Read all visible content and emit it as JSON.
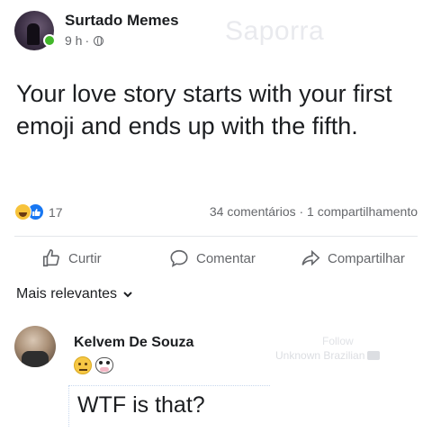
{
  "post": {
    "page_name": "Surtado Memes",
    "time": "9 h",
    "separator": "·",
    "watermark": "Saporra",
    "text": "Your love story starts with your first emoji and ends up with the fifth."
  },
  "stats": {
    "reaction_count": "17",
    "summary": "34 comentários · 1 compartilhamento"
  },
  "actions": {
    "like": "Curtir",
    "comment": "Comentar",
    "share": "Compartilhar"
  },
  "sort": {
    "label": "Mais relevantes"
  },
  "comment": {
    "author": "Kelvem De Souza",
    "text": "WTF is that?",
    "follow_watermark": "Follow",
    "channel_watermark": "Unknown Brazilian"
  },
  "colors": {
    "like_blue": "#1877f2",
    "online_green": "#42b72a",
    "meta_gray": "#65676b"
  },
  "icons": [
    "globe-icon",
    "haha-reaction-icon",
    "like-reaction-icon",
    "thumbs-up-icon",
    "comment-bubble-icon",
    "share-arrow-icon",
    "chevron-down-icon",
    "neutral-face-icon",
    "cow-face-icon",
    "camera-icon"
  ]
}
